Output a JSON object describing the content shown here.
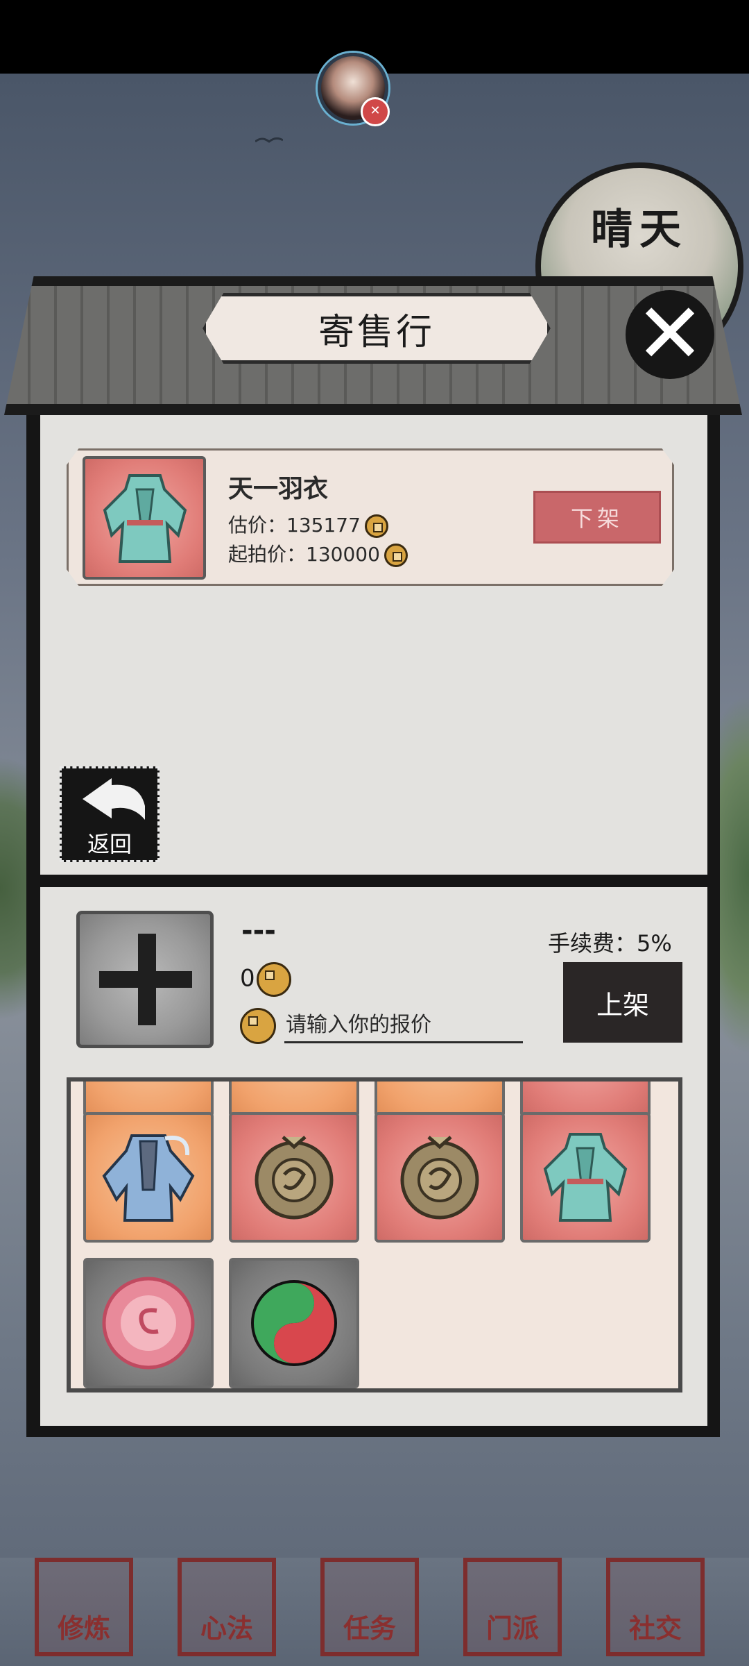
{
  "weather": {
    "label": "晴天"
  },
  "header": {
    "title": "寄售行"
  },
  "listing": {
    "item_name": "天一羽衣",
    "estimate_label": "估价：",
    "estimate_value": "135177",
    "start_label": "起拍价：",
    "start_value": "130000",
    "unlist_label": "下架"
  },
  "back": {
    "label": "返回"
  },
  "sell": {
    "item_name": "---",
    "price": "0",
    "input_placeholder": "请输入你的报价",
    "fee_text": "手续费：5%",
    "list_label": "上架"
  },
  "inventory": {
    "items": [
      {
        "icon": "blue-robe-icon",
        "frame": "orange"
      },
      {
        "icon": "bronze-medallion-icon",
        "frame": "red"
      },
      {
        "icon": "bronze-medallion-icon",
        "frame": "red"
      },
      {
        "icon": "teal-robe-icon",
        "frame": "red"
      },
      {
        "icon": "pink-swirl-orb-icon",
        "frame": "gray"
      },
      {
        "icon": "red-green-pill-icon",
        "frame": "gray"
      }
    ]
  },
  "bottom_nav": {
    "items": [
      {
        "label": "修炼"
      },
      {
        "label": "心法"
      },
      {
        "label": "任务"
      },
      {
        "label": "门派"
      },
      {
        "label": "社交"
      }
    ]
  },
  "colors": {
    "accent_red": "#c9676a",
    "frame_red": "#e07c77",
    "frame_orange": "#f1a26c",
    "ink": "#151515"
  }
}
